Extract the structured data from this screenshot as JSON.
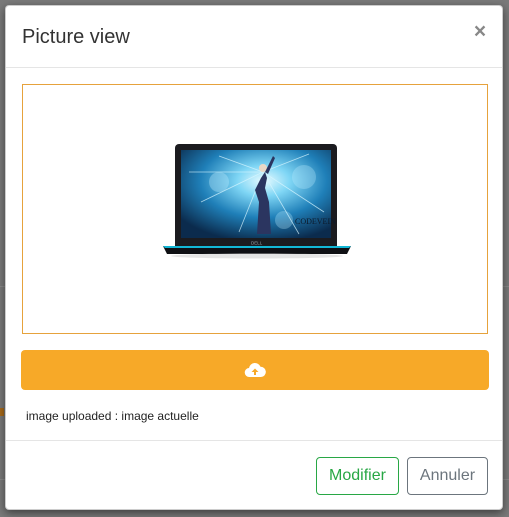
{
  "modal": {
    "title": "Picture view",
    "close_label": "×"
  },
  "preview": {
    "image_brand_text": "CODEVEIN",
    "laptop_logo": "DELL"
  },
  "upload": {
    "icon": "cloud-upload-icon",
    "status_text": "image uploaded : image actuelle"
  },
  "footer": {
    "modify_label": "Modifier",
    "cancel_label": "Annuler"
  },
  "colors": {
    "accent_orange": "#f7a928",
    "preview_border": "#e6a23c",
    "success_green": "#28a745",
    "secondary_gray": "#6c757d"
  }
}
